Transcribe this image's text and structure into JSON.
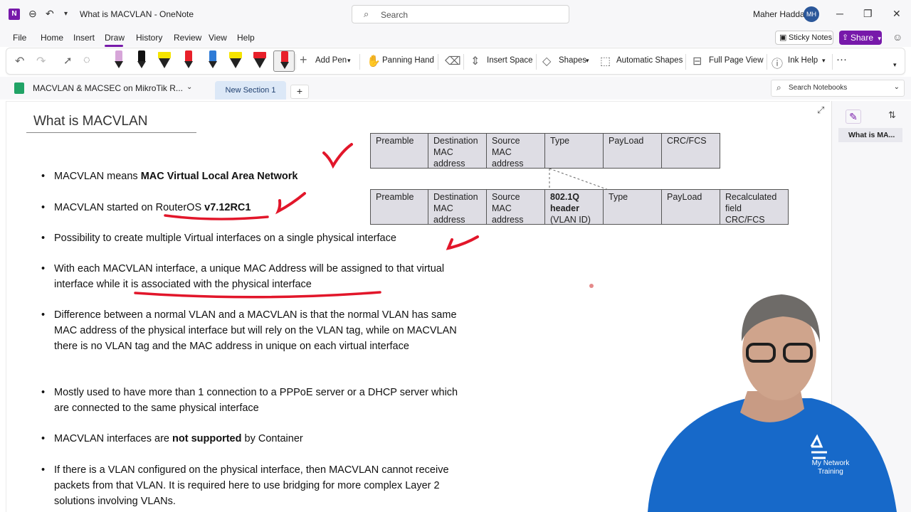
{
  "window": {
    "title": "What is MACVLAN  -  OneNote",
    "app_logo": "N",
    "search_placeholder": "Search",
    "user_name": "Maher Haddad",
    "user_initials": "MH",
    "minimize": "─",
    "restore": "❐",
    "close": "✕"
  },
  "menu": [
    "File",
    "Home",
    "Insert",
    "Draw",
    "History",
    "Review",
    "View",
    "Help"
  ],
  "header_buttons": {
    "sticky_notes": "Sticky Notes",
    "share": "Share"
  },
  "ribbon": {
    "add_pen": "Add Pen",
    "panning_hand": "Panning Hand",
    "insert_space": "Insert Space",
    "shapes": "Shapes",
    "automatic_shapes": "Automatic Shapes",
    "full_page_view": "Full Page View",
    "ink_help": "Ink Help",
    "more": "···",
    "pens": [
      {
        "kind": "pen",
        "color": "#d7a6d9"
      },
      {
        "kind": "pen",
        "color": "#111111"
      },
      {
        "kind": "highlighter",
        "color": "#f5e400"
      },
      {
        "kind": "pen",
        "color": "#e8202a"
      },
      {
        "kind": "pen",
        "color": "#2e7bd6"
      },
      {
        "kind": "highlighter",
        "color": "#f5e400"
      },
      {
        "kind": "highlighter",
        "color": "#e8202a"
      },
      {
        "kind": "pen",
        "color": "#e8202a",
        "selected": true
      }
    ]
  },
  "notebook": {
    "name": "MACVLAN & MACSEC on MikroTik R...",
    "section": "New Section 1",
    "add_section": "+",
    "search_placeholder": "Search Notebooks"
  },
  "page": {
    "title": "What is MACVLAN",
    "bullets": [
      {
        "parts": [
          {
            "t": "MACVLAN means "
          },
          {
            "t": "MAC Virtual Local Area Network",
            "b": true
          }
        ]
      },
      {
        "parts": [
          {
            "t": "MACVLAN started on RouterOS "
          },
          {
            "t": "v7.12RC1",
            "b": true
          }
        ]
      },
      {
        "parts": [
          {
            "t": "Possibility to create multiple Virtual interfaces on a single physical interface"
          }
        ]
      },
      {
        "parts": [
          {
            "t": "With each MACVLAN interface, a unique MAC Address will be assigned to that virtual interface while it is associated with the physical interface"
          }
        ]
      },
      {
        "parts": [
          {
            "t": "Difference between a normal VLAN and a MACVLAN is that the normal VLAN has same MAC address of the physical interface but will rely on the VLAN tag, while on MACVLAN there is no VLAN tag and the MAC address in unique on each virtual interface"
          }
        ]
      },
      {
        "parts": [
          {
            "t": "Mostly used to have more than 1 connection to a PPPoE server or a DHCP server which are connected to the same physical interface"
          }
        ]
      },
      {
        "parts": [
          {
            "t": "MACVLAN interfaces are "
          },
          {
            "t": "not supported",
            "b": true
          },
          {
            "t": " by Container"
          }
        ]
      },
      {
        "parts": [
          {
            "t": "If there is a VLAN configured on the physical interface, then MACVLAN cannot receive packets from that VLAN. It is required here to  use bridging for more complex Layer 2 solutions involving VLANs."
          }
        ]
      }
    ],
    "frame_untagged": [
      "Preamble",
      "Destination\nMAC\naddress",
      "Source\nMAC\naddress",
      "Type",
      "PayLoad",
      "CRC/FCS"
    ],
    "frame_tagged": [
      {
        "text": "Preamble"
      },
      {
        "text": "Destination\nMAC\naddress"
      },
      {
        "text": "Source\nMAC\naddress"
      },
      {
        "text": "802.1Q\nheader\n",
        "extra": "(VLAN ID)",
        "bold": true
      },
      {
        "text": "Type"
      },
      {
        "text": "PayLoad"
      },
      {
        "text": "Recalculated\nfield\nCRC/FCS"
      }
    ]
  },
  "side_panel": {
    "page_entry": "What is MA..."
  },
  "webcam": {
    "brand_line1": "My Network",
    "brand_line2": "Training"
  },
  "colors": {
    "accent": "#7719aa",
    "ink": "#e2162a",
    "cell_fill": "#dedde4"
  }
}
